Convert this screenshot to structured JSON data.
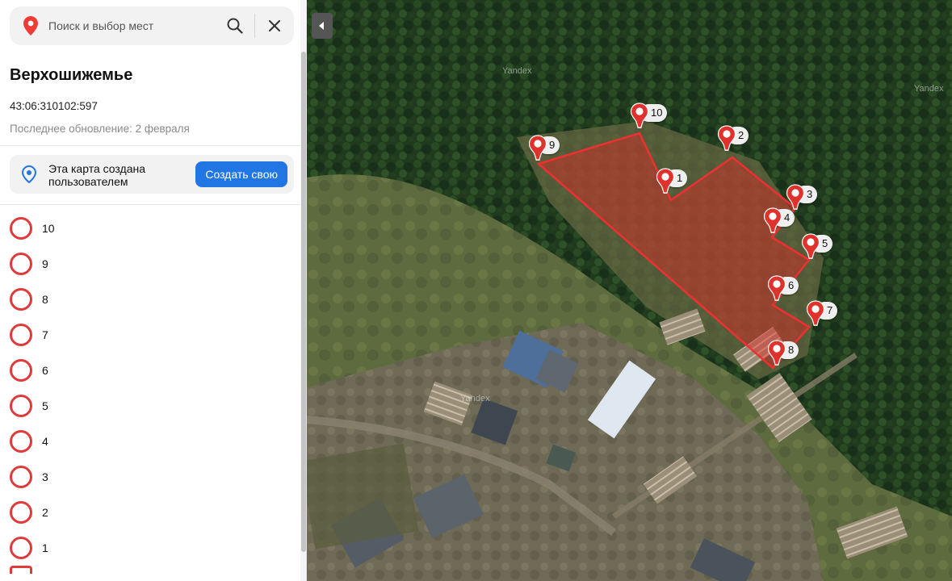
{
  "search": {
    "placeholder": "Поиск и выбор мест"
  },
  "place": {
    "title": "Верхошижемье",
    "cadastral_number": "43:06:310102:597",
    "last_update": "Последнее обновление: 2 февраля"
  },
  "banner": {
    "text": "Эта карта создана пользователем",
    "create_button": "Создать свою"
  },
  "points_list": [
    "10",
    "9",
    "8",
    "7",
    "6",
    "5",
    "4",
    "3",
    "2",
    "1"
  ],
  "map": {
    "watermark": "Yandex",
    "markers": [
      {
        "label": "1",
        "pos": "m1"
      },
      {
        "label": "2",
        "pos": "m2"
      },
      {
        "label": "3",
        "pos": "m3"
      },
      {
        "label": "4",
        "pos": "m4"
      },
      {
        "label": "5",
        "pos": "m5"
      },
      {
        "label": "6",
        "pos": "m6"
      },
      {
        "label": "7",
        "pos": "m7"
      },
      {
        "label": "8",
        "pos": "m8"
      },
      {
        "label": "9",
        "pos": "m9"
      },
      {
        "label": "10",
        "pos": "m10"
      }
    ]
  },
  "colors": {
    "accent_red": "#e03b3b",
    "button_blue": "#2276e3",
    "polygon_fill": "rgba(230,40,40,0.45)"
  },
  "icons": {
    "search_pin": "map-pin-icon",
    "search": "magnifier-icon",
    "close": "close-icon",
    "banner": "geo-location-icon",
    "collapse": "chevron-left-icon"
  }
}
